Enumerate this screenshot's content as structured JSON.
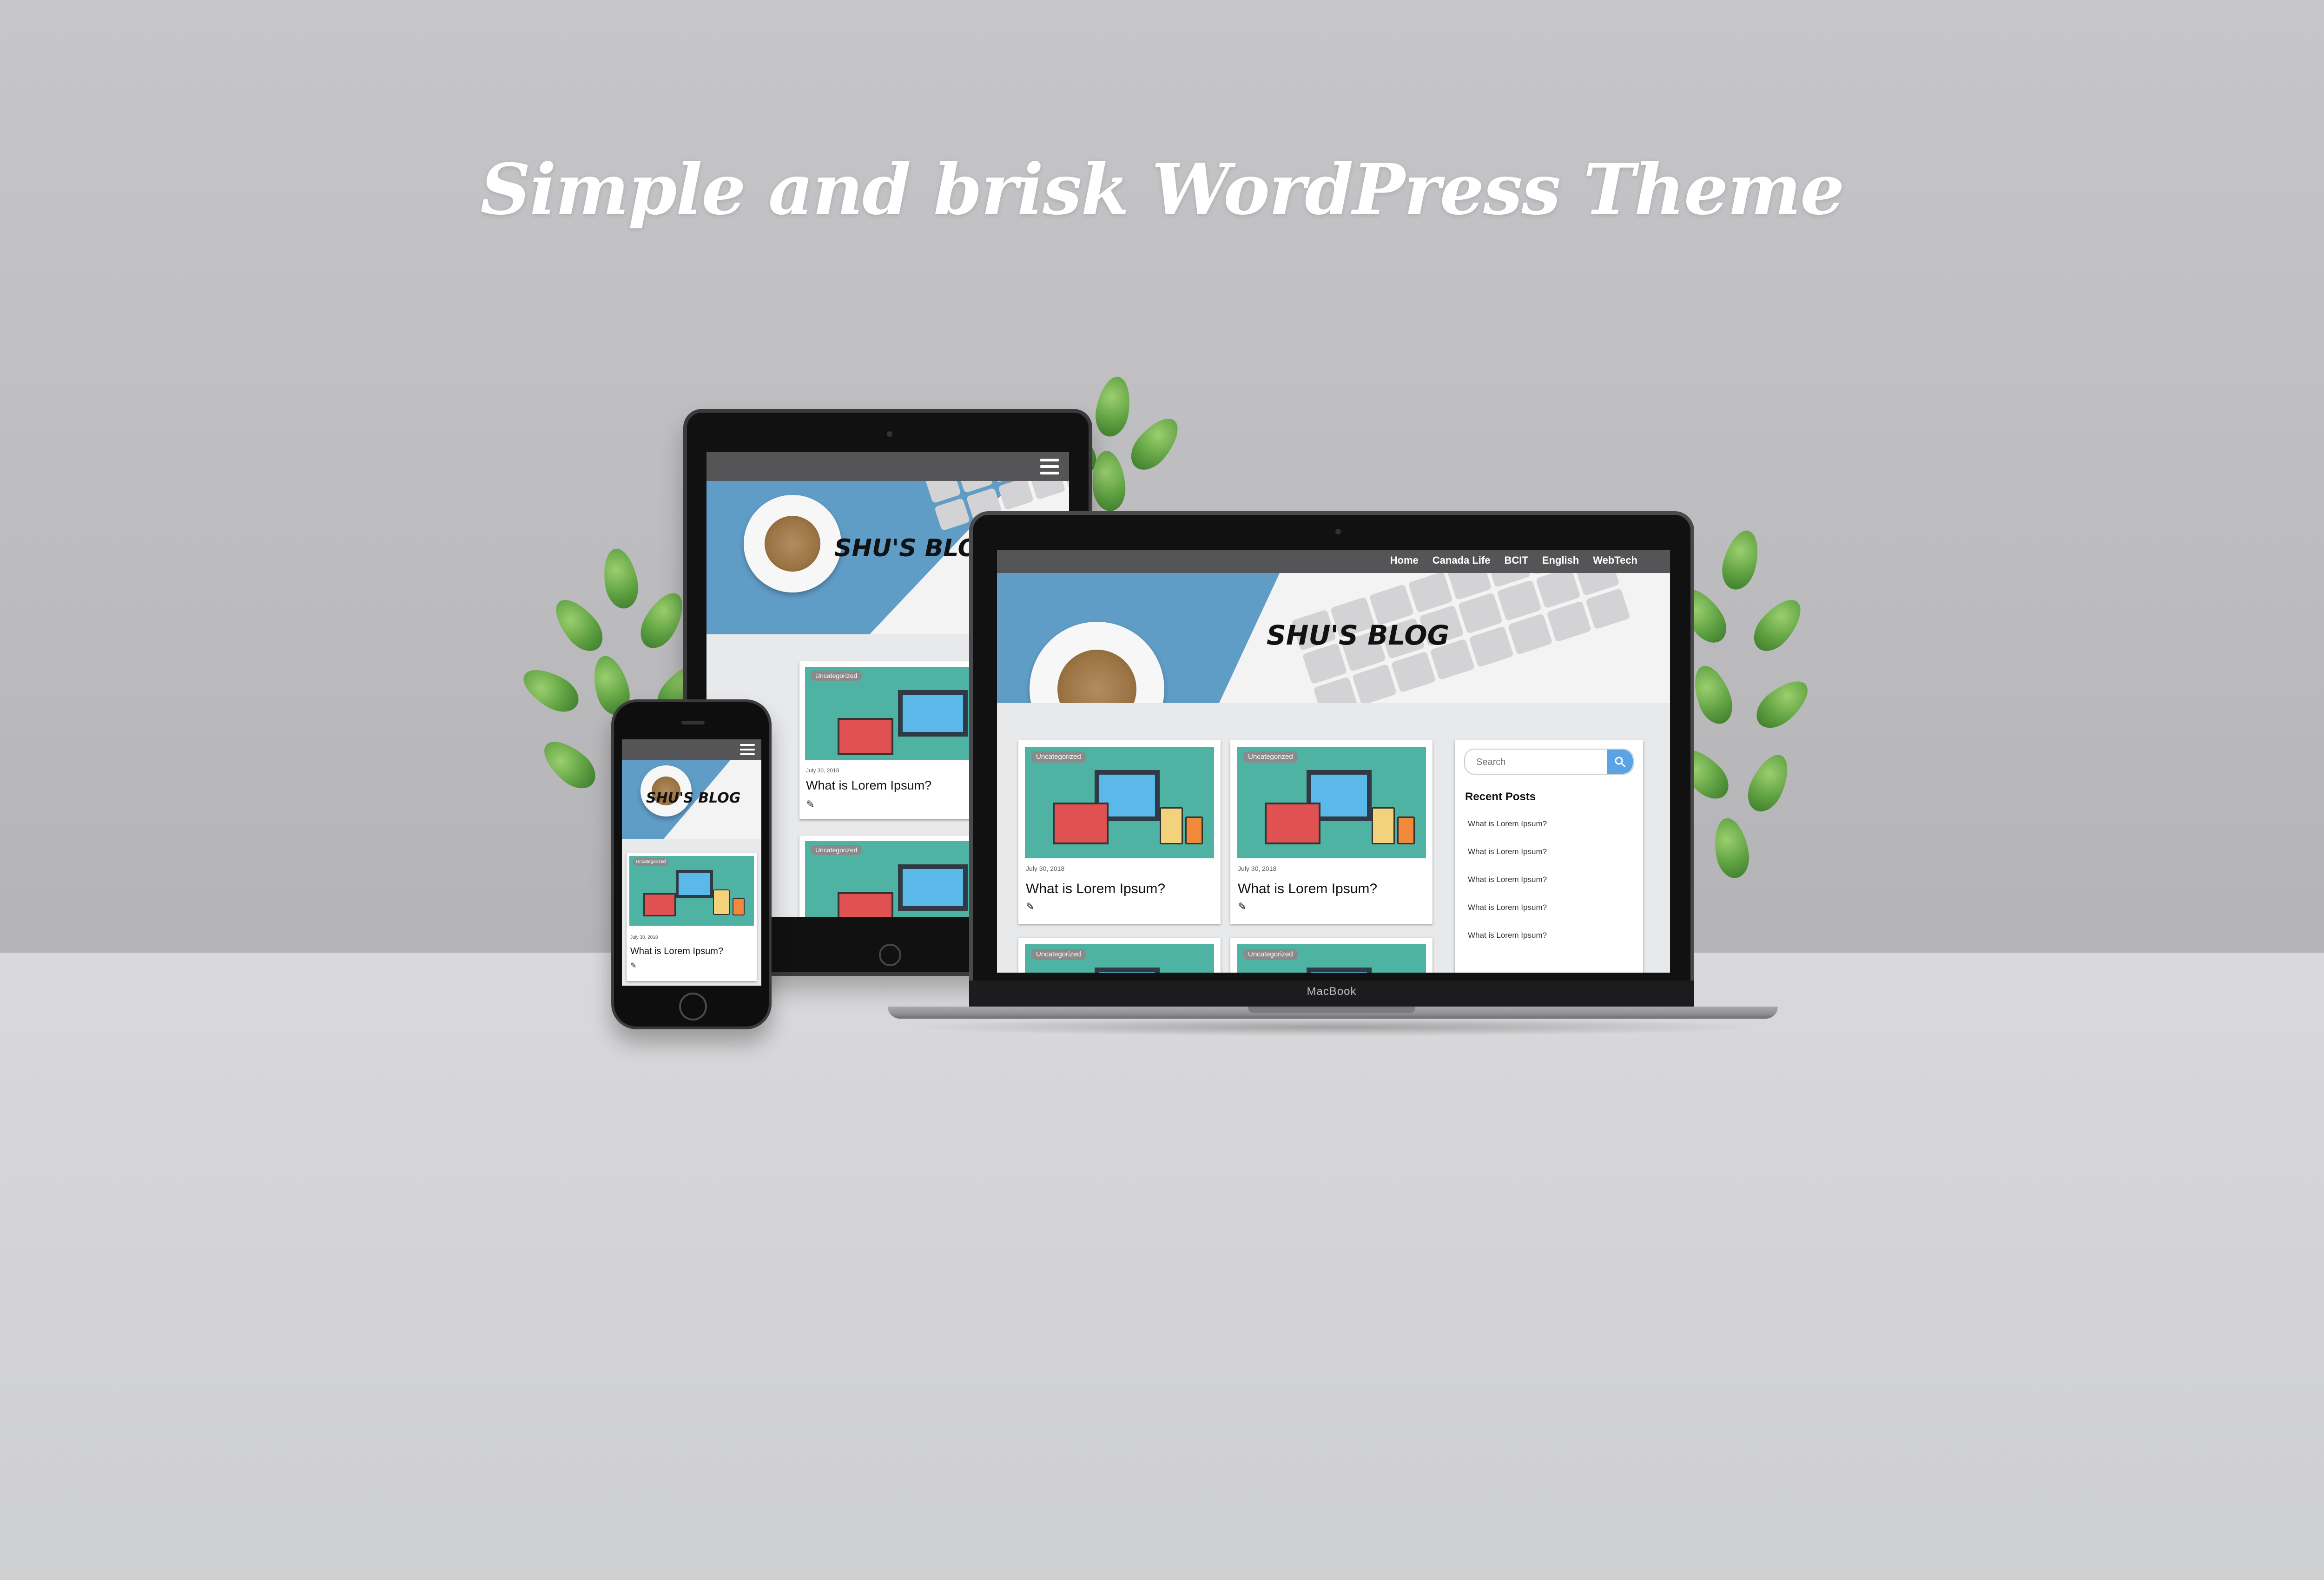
{
  "headline": "Simple and brisk WordPress Theme",
  "site": {
    "logo": "SHU'S BLOG",
    "nav": [
      "Home",
      "Canada Life",
      "BCIT",
      "English",
      "WebTech"
    ],
    "post": {
      "category": "Uncategorized",
      "date": "July 30, 2018",
      "title": "What is Lorem Ipsum?"
    },
    "search_placeholder": "Search",
    "recent_posts_title": "Recent Posts",
    "recent_posts": [
      "What is Lorem Ipsum?",
      "What is Lorem Ipsum?",
      "What is Lorem Ipsum?",
      "What is Lorem Ipsum?",
      "What is Lorem Ipsum?"
    ]
  },
  "laptop_brand": "MacBook",
  "colors": {
    "banner_blue": "#5f9cc6",
    "topbar": "#555557",
    "thumb_teal": "#4eb3a2",
    "search_button": "#5aa4e6"
  },
  "icons": [
    "hamburger-menu-icon",
    "search-icon",
    "pencil-icon",
    "coffee-cup-icon"
  ]
}
